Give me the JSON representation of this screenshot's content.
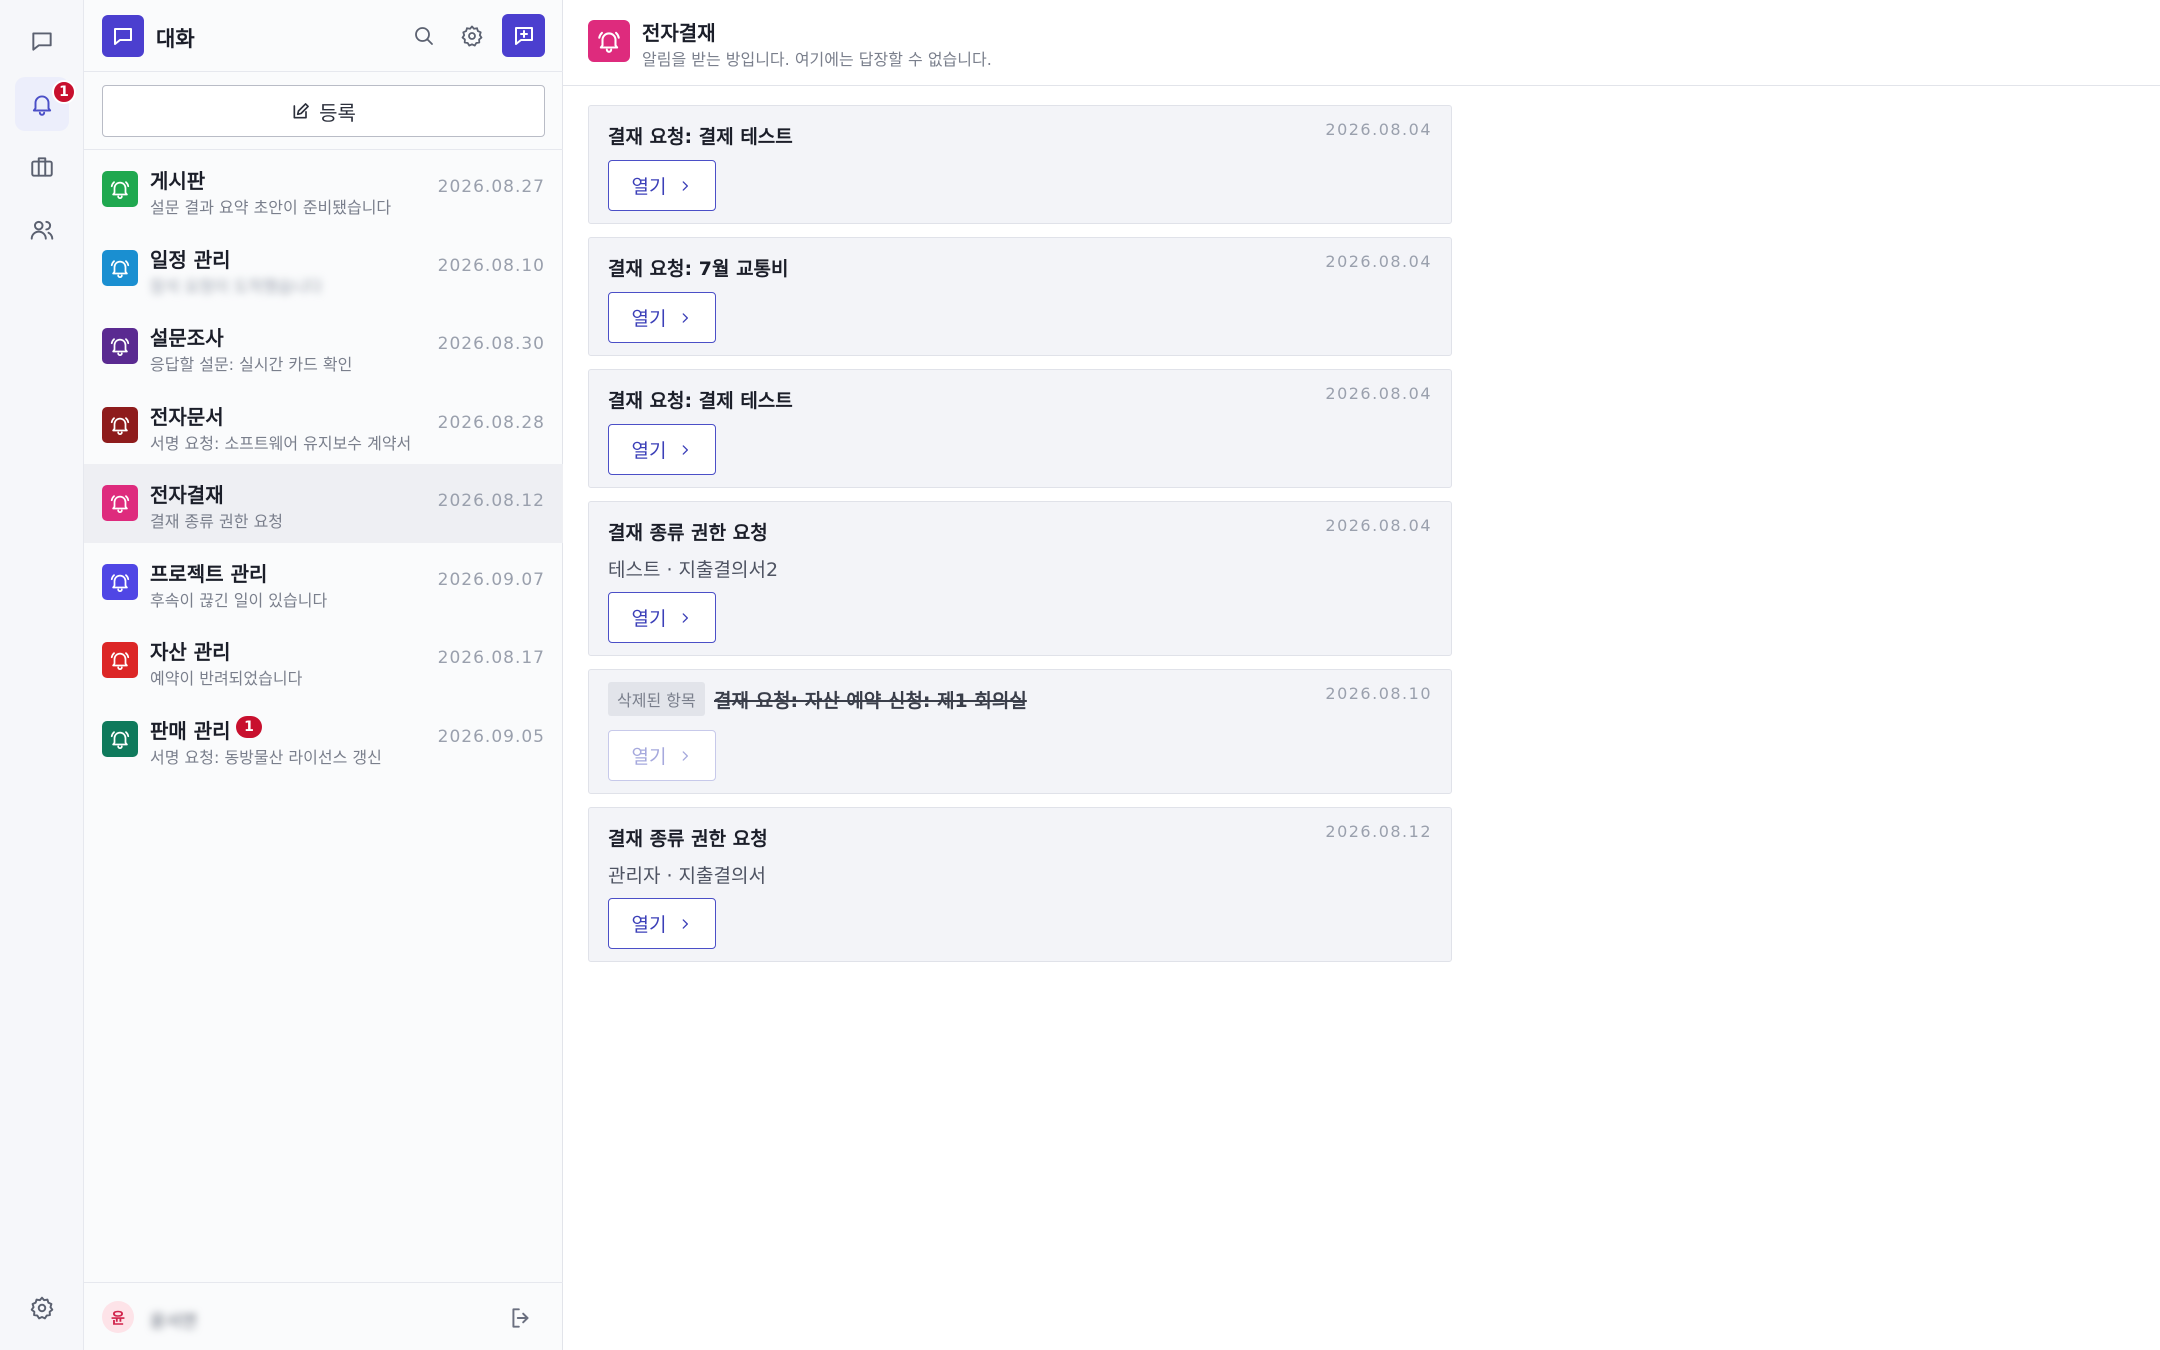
{
  "rail": {
    "notification_badge": "1"
  },
  "sidebar": {
    "title": "대화",
    "register_label": "등록",
    "conversations": [
      {
        "name": "게시판",
        "preview": "설문 결과 요약 초안이 준비됐습니다",
        "date": "2026.08.27",
        "color": "#1fa84f",
        "badge": ""
      },
      {
        "name": "일정 관리",
        "preview": "참석 요청이 도착했습니다",
        "date": "2026.08.10",
        "color": "#1a8fd1",
        "badge": ""
      },
      {
        "name": "설문조사",
        "preview": "응답할 설문: 실시간 카드 확인",
        "date": "2026.08.30",
        "color": "#5a2a91",
        "badge": ""
      },
      {
        "name": "전자문서",
        "preview": "서명 요청: 소프트웨어 유지보수 계약서",
        "date": "2026.08.28",
        "color": "#8e1c1c",
        "badge": ""
      },
      {
        "name": "전자결재",
        "preview": "결재 종류 권한 요청",
        "date": "2026.08.12",
        "color": "#de2b7d",
        "badge": ""
      },
      {
        "name": "프로젝트 관리",
        "preview": "후속이 끊긴 일이 있습니다",
        "date": "2026.09.07",
        "color": "#4f46e5",
        "badge": ""
      },
      {
        "name": "자산 관리",
        "preview": "예약이 반려되었습니다",
        "date": "2026.08.17",
        "color": "#dc2626",
        "badge": ""
      },
      {
        "name": "판매 관리",
        "preview": "서명 요청: 동방물산 라이선스 갱신",
        "date": "2026.09.05",
        "color": "#0f7a5c",
        "badge": "1"
      }
    ],
    "user": {
      "avatar_initial": "윤",
      "name": "윤서연"
    }
  },
  "main": {
    "title": "전자결재",
    "description": "알림을 받는 방입니다. 여기에는 답장할 수 없습니다.",
    "open_label": "열기",
    "deleted_label": "삭제된 항목",
    "cards": [
      {
        "title": "결재 요청: 결제 테스트",
        "date": "2026.08.04",
        "subline": ""
      },
      {
        "title": "결재 요청: 7월 교통비",
        "date": "2026.08.04",
        "subline": ""
      },
      {
        "title": "결재 요청: 결제 테스트",
        "date": "2026.08.04",
        "subline": ""
      },
      {
        "title": "결재 종류 권한 요청",
        "date": "2026.08.04",
        "subline": "테스트 · 지출결의서2"
      },
      {
        "title": "결재 요청: 자산 예약 신청: 제1 회의실",
        "date": "2026.08.10",
        "subline": ""
      },
      {
        "title": "결재 종류 권한 요청",
        "date": "2026.08.12",
        "subline": "관리자 · 지출결의서"
      }
    ]
  }
}
